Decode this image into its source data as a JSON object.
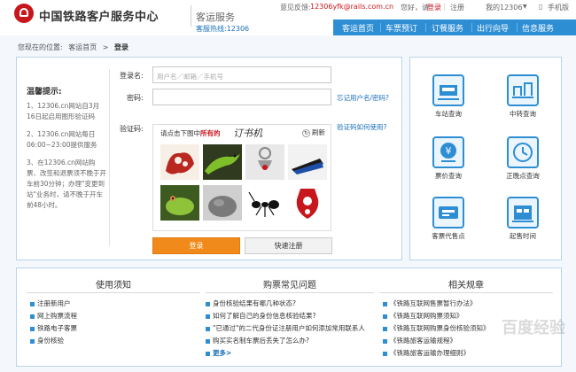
{
  "header": {
    "title": "中国铁路客户服务中心",
    "subtitle": "客运服务",
    "hotline": "客服热线:12306",
    "feedback_label": "意见反馈:",
    "feedback_email": "12306yfk@rails.com.cn",
    "greeting": "您好，请",
    "login_link": "登录",
    "register_link": "注册",
    "my_account": "我的12306",
    "mobile": "手机版"
  },
  "nav": {
    "items": [
      "客运首页",
      "车票预订",
      "订餐服务",
      "出行向导",
      "信息服务"
    ]
  },
  "breadcrumb": {
    "prefix": "您现在的位置:",
    "home": "客运首页",
    "separator": ">",
    "current": "登录"
  },
  "tips": {
    "title": "温馨提示:",
    "items": [
      "1、12306.cn网站自3月16日起启用图形验证码",
      "2、12306.cn网站每日06:00~23:00提供服务",
      "3、在12306.cn网站购票、改签和退票须不晚于开车前30分钟；办理\"变更到站\"业务时，请不晚于开车前48小时。"
    ]
  },
  "form": {
    "username_label": "登录名:",
    "username_placeholder": "用户名／邮箱／手机号",
    "password_label": "密码:",
    "forgot_link": "忘记用户名/密码?",
    "captcha_label": "验证码:",
    "captcha_help_link": "验证码如何使用?",
    "captcha_prompt_a": "请点击下图中",
    "captcha_prompt_b": "所有的",
    "captcha_target": "订书机",
    "refresh_label": "刷新",
    "login_button": "登录",
    "register_button": "快速注册"
  },
  "services": [
    {
      "label": "车站查询",
      "icon": "station-query-icon"
    },
    {
      "label": "中转查询",
      "icon": "transfer-query-icon"
    },
    {
      "label": "票价查询",
      "icon": "fare-query-icon"
    },
    {
      "label": "正晚点查询",
      "icon": "delay-query-icon"
    },
    {
      "label": "客票代售点",
      "icon": "ticket-agent-icon"
    },
    {
      "label": "起售时间",
      "icon": "sale-time-icon"
    }
  ],
  "bottom": {
    "col1": {
      "title": "使用须知",
      "items": [
        "注册新用户",
        "网上购票流程",
        "铁路电子客票",
        "身份核验"
      ]
    },
    "col2": {
      "title": "购票常见问题",
      "items": [
        "身份核验结果有哪几种状态?",
        "如何了解自己的身份信息核验结果?",
        "\"已通过\"的二代身份证注册用户如何添加常用联系人",
        "购买实名制车票后丢失了怎么办?"
      ],
      "more": "更多>"
    },
    "col3": {
      "title": "相关规章",
      "items": [
        "《铁路互联网售票暂行办法》",
        "《铁路互联网购票须知》",
        "《铁路互联网购票身份核验须知》",
        "《铁路旅客运输规程》",
        "《铁路旅客运输办理细则》"
      ]
    }
  },
  "watermark": "百度经验"
}
